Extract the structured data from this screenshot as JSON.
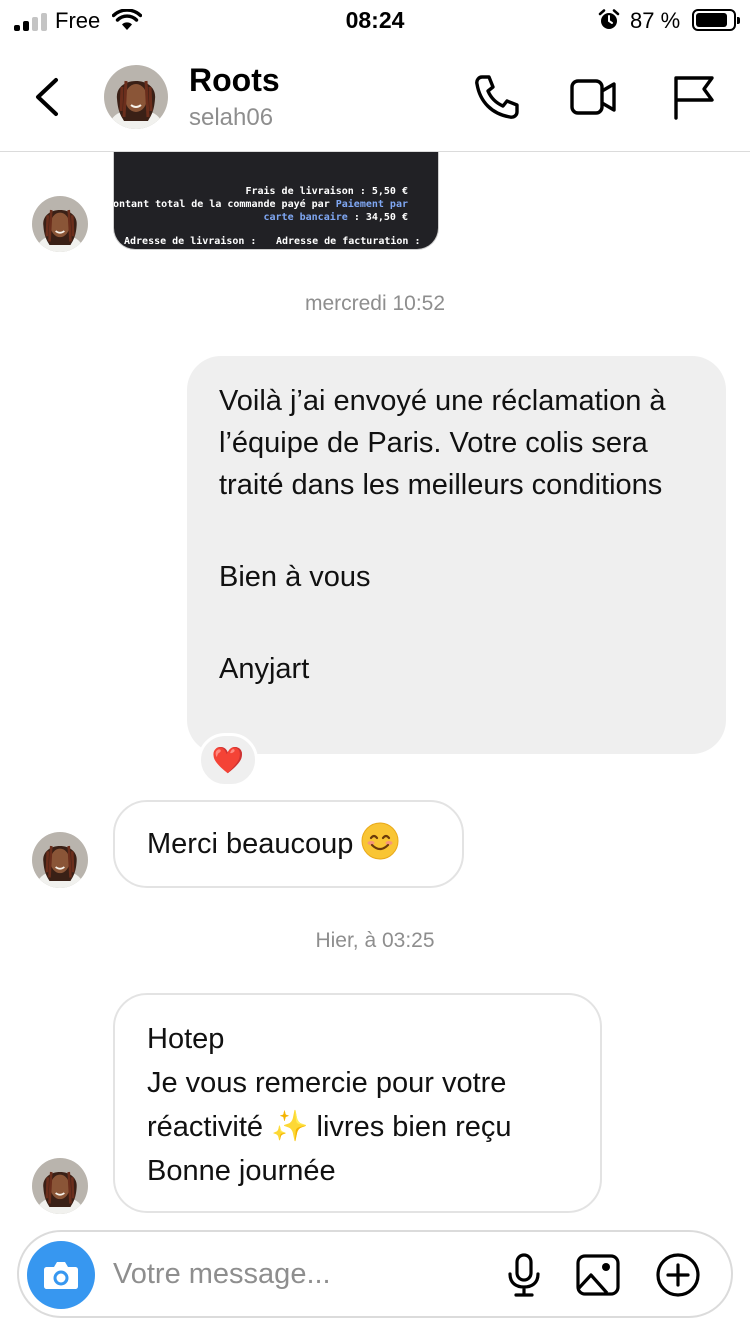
{
  "status_bar": {
    "carrier": "Free",
    "time": "08:24",
    "battery_percent": "87 %",
    "battery_level": 0.87,
    "signal_bars": 2,
    "icons": [
      "signal-icon",
      "wifi-icon",
      "alarm-icon",
      "battery-icon"
    ]
  },
  "header": {
    "name": "Roots",
    "handle": "selah06",
    "actions": [
      "back-icon",
      "phone-icon",
      "video-icon",
      "flag-icon"
    ]
  },
  "thread": {
    "shared_image": {
      "delivery_fee": "Frais de livraison : 5,50 €",
      "total_prefix": "Montant total de la commande payé par",
      "payment_method_1": "Paiement par",
      "payment_method_2": "carte bancaire",
      "total_amount": ": 34,50 €",
      "delivery_address": "Adresse de livraison :",
      "billing_address": "Adresse de facturation :"
    },
    "timestamp_1": "mercredi 10:52",
    "outgoing_message": {
      "paragraph_1": "Voilà j’ai envoyé une réclamation à l’équipe de Paris. Votre colis sera traité dans les meilleurs conditions",
      "paragraph_2": "Bien à vous",
      "paragraph_3": "Anyjart",
      "reaction": "❤️"
    },
    "incoming_message_1": {
      "text": "Merci beaucoup",
      "emoji": "smiling-face-icon"
    },
    "timestamp_2": "Hier, à 03:25",
    "incoming_message_2": {
      "line_1": "Hotep",
      "line_2": "Je vous remercie pour votre",
      "line_3_start": "réactivité",
      "line_3_emoji": "✨",
      "line_3_end": "livres bien reçu",
      "line_4": "Bonne journée"
    }
  },
  "composer": {
    "placeholder": "Votre message...",
    "actions": [
      "camera-icon",
      "microphone-icon",
      "gallery-icon",
      "add-icon"
    ]
  },
  "colors": {
    "accent": "#3797f0",
    "outgoing_bubble": "#efefef",
    "secondary_text": "#8e8e8e",
    "border": "#dbdbdb"
  }
}
